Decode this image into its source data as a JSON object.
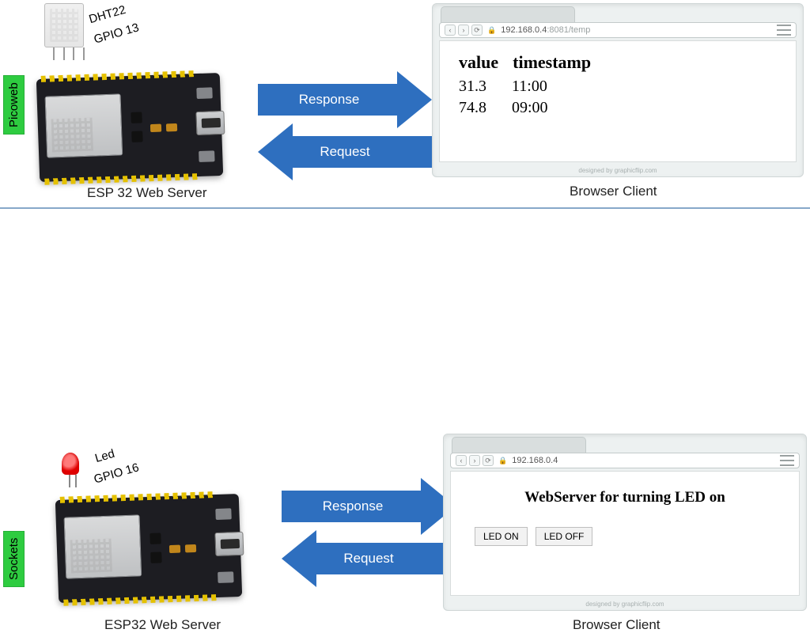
{
  "top": {
    "sidetag": "Picoweb",
    "sensor": {
      "name": "DHT22",
      "pin": "GPIO 13"
    },
    "board_caption": "ESP 32 Web Server",
    "arrow_response": "Response",
    "arrow_request": "Request",
    "browser": {
      "url_host": "192.168.0.4",
      "url_rest": ":8081/temp",
      "table": {
        "headers": [
          "value",
          "timestamp"
        ],
        "rows": [
          {
            "value": "31.3",
            "timestamp": "11:00"
          },
          {
            "value": "74.8",
            "timestamp": "09:00"
          }
        ]
      },
      "footer": "designed by graphicflip.com"
    },
    "client_caption": "Browser Client"
  },
  "bottom": {
    "sidetag": "Sockets",
    "led": {
      "name": "Led",
      "pin": "GPIO 16"
    },
    "board_caption": "ESP32 Web Server",
    "arrow_response": "Response",
    "arrow_request": "Request",
    "browser": {
      "url_host": "192.168.0.4",
      "url_rest": "",
      "heading": "WebServer for turning LED on",
      "buttons": {
        "on": "LED ON",
        "off": "LED OFF"
      },
      "footer": "designed by graphicflip.com"
    },
    "client_caption": "Browser Client"
  }
}
